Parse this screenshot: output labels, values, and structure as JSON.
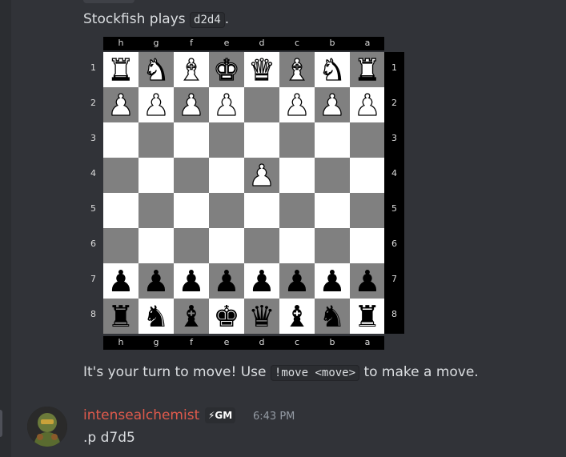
{
  "bot_message": {
    "prefix": "Stockfish plays ",
    "move_code": "d2d4",
    "suffix": "."
  },
  "board": {
    "files": [
      "h",
      "g",
      "f",
      "e",
      "d",
      "c",
      "b",
      "a"
    ],
    "ranks": [
      "1",
      "2",
      "3",
      "4",
      "5",
      "6",
      "7",
      "8"
    ],
    "rows": [
      [
        "♜w",
        "♞w",
        "♝w",
        "♚w",
        "♛w",
        "♝w",
        "♞w",
        "♜w"
      ],
      [
        "♟w",
        "♟w",
        "♟w",
        "♟w",
        "",
        "♟w",
        "♟w",
        "♟w"
      ],
      [
        "",
        "",
        "",
        "",
        "",
        "",
        "",
        ""
      ],
      [
        "",
        "",
        "",
        "",
        "♟w",
        "",
        "",
        ""
      ],
      [
        "",
        "",
        "",
        "",
        "",
        "",
        "",
        ""
      ],
      [
        "",
        "",
        "",
        "",
        "",
        "",
        "",
        ""
      ],
      [
        "♟b",
        "♟b",
        "♟b",
        "♟b",
        "♟b",
        "♟b",
        "♟b",
        "♟b"
      ],
      [
        "♜b",
        "♞b",
        "♝b",
        "♚b",
        "♛b",
        "♝b",
        "♞b",
        "♜b"
      ]
    ]
  },
  "prompt_message": {
    "prefix": "It's your turn to move! Use ",
    "command_code": "!move <move>",
    "suffix": " to make a move."
  },
  "user_message": {
    "username": "intensealchemist",
    "role_badge": "⚡GM",
    "timestamp": "6:43 PM",
    "text": ".p d7d5"
  },
  "colors": {
    "background": "#313338",
    "username": "#e05a4c",
    "light_square": "#ffffff",
    "dark_square": "#808080"
  }
}
